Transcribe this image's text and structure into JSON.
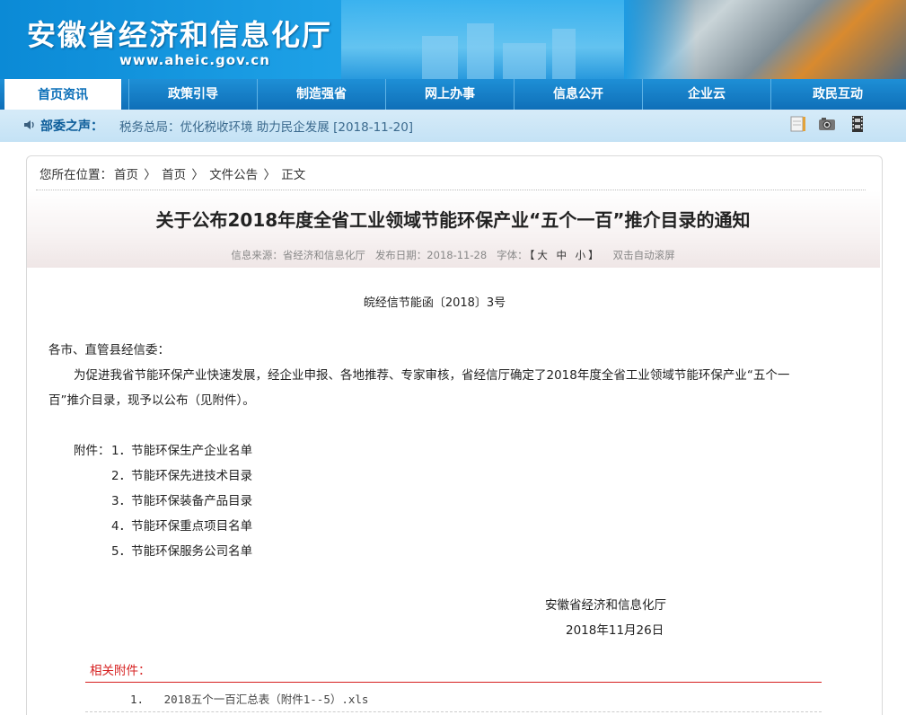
{
  "header": {
    "site_title": "安徽省经济和信息化厅",
    "site_url": "www.aheic.gov.cn"
  },
  "nav": {
    "items": [
      "首页资讯",
      "政策引导",
      "制造强省",
      "网上办事",
      "信息公开",
      "企业云",
      "政民互动"
    ],
    "active_index": 0
  },
  "ticker": {
    "label": "部委之声：",
    "text": "税务总局：优化税收环境 助力民企发展 [2018-11-20]",
    "icons": [
      "notepad-icon",
      "camera-icon",
      "film-icon"
    ]
  },
  "breadcrumb": {
    "prefix": "您所在位置：",
    "items": [
      "首页",
      "首页",
      "文件公告",
      "正文"
    ],
    "separator": "〉"
  },
  "article": {
    "title": "关于公布2018年度全省工业领域节能环保产业“五个一百”推介目录的通知",
    "meta": {
      "source": "信息来源：省经济和信息化厅",
      "date": "发布日期：2018-11-28",
      "font_label": "字体：",
      "font_sizes": "【大 中 小】",
      "scroll": "双击自动滚屏"
    },
    "doc_number": "皖经信节能函〔2018〕3号",
    "salutation": "各市、直管县经信委：",
    "body_line1": "为促进我省节能环保产业快速发展，经企业申报、各地推荐、专家审核，省经信厅确定了2018年度全省工业领域节能环保产业“五个一",
    "body_line2": "百”推介目录，现予以公布（见附件）。",
    "attachments_label": "附件：",
    "attachments": [
      "1．节能环保生产企业名单",
      "2．节能环保先进技术目录",
      "3．节能环保装备产品目录",
      "4．节能环保重点项目名单",
      "5．节能环保服务公司名单"
    ],
    "signature_org": "安徽省经济和信息化厅",
    "signature_date": "2018年11月26日"
  },
  "related": {
    "heading": "相关附件：",
    "files": [
      {
        "num": "1.",
        "name": "2018五个一百汇总表（附件1--5）.xls"
      }
    ]
  }
}
